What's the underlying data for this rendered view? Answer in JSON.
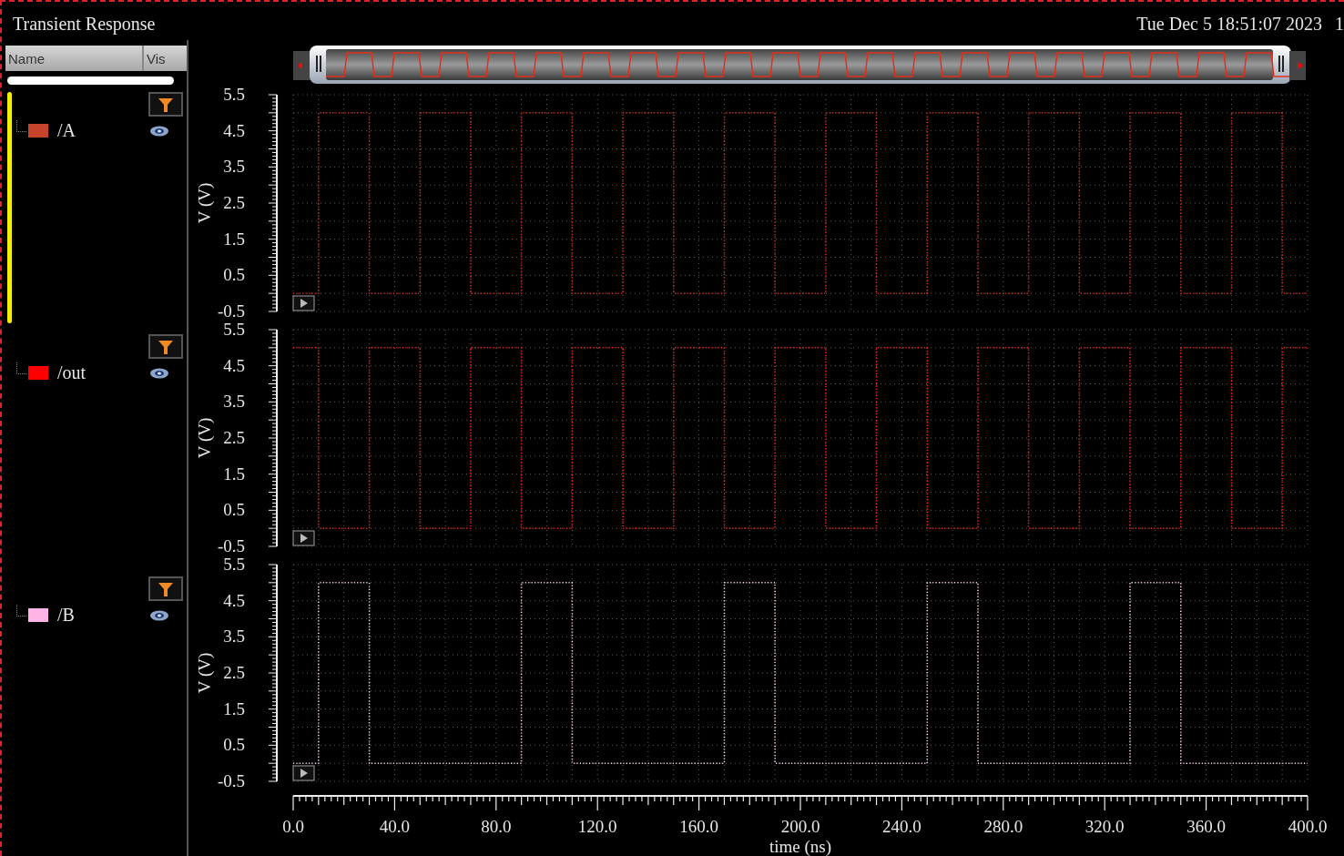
{
  "title": "Transient Response",
  "timestamp": "Tue Dec 5 18:51:07 2023",
  "cut_text": "1",
  "columns": [
    "Name",
    "Vis"
  ],
  "signals": [
    {
      "name": "/A",
      "color": "#c8432b",
      "selected": true,
      "chart_data": {
        "type": "line",
        "ylabel": "V (V)",
        "xlim": [
          0,
          400
        ],
        "ylim": [
          -0.5,
          5.5
        ],
        "yticks": [
          -0.5,
          0.5,
          1.5,
          2.5,
          3.5,
          4.5,
          5.5
        ],
        "x": [
          0,
          10,
          10,
          30,
          30,
          50,
          50,
          70,
          70,
          90,
          90,
          110,
          110,
          130,
          130,
          150,
          150,
          170,
          170,
          190,
          190,
          210,
          210,
          230,
          230,
          250,
          250,
          270,
          270,
          290,
          290,
          310,
          310,
          330,
          330,
          350,
          350,
          370,
          370,
          390,
          390,
          400
        ],
        "grid": true,
        "series": [
          {
            "line_style": "dotted",
            "color": "#d42a1e",
            "values": [
              0,
              0,
              5,
              5,
              0,
              0,
              5,
              5,
              0,
              0,
              5,
              5,
              0,
              0,
              5,
              5,
              0,
              0,
              5,
              5,
              0,
              0,
              5,
              5,
              0,
              0,
              5,
              5,
              0,
              0,
              5,
              5,
              0,
              0,
              5,
              5,
              0,
              0,
              5,
              5,
              0,
              0
            ]
          }
        ]
      }
    },
    {
      "name": "/out",
      "color": "#ff0000",
      "selected": false,
      "chart_data": {
        "type": "line",
        "ylabel": "V (V)",
        "xlim": [
          0,
          400
        ],
        "ylim": [
          -0.5,
          5.5
        ],
        "yticks": [
          -0.5,
          0.5,
          1.5,
          2.5,
          3.5,
          4.5,
          5.5
        ],
        "x": [
          0,
          10,
          10,
          30,
          30,
          50,
          50,
          70,
          70,
          90,
          90,
          110,
          110,
          130,
          130,
          150,
          150,
          170,
          170,
          190,
          190,
          210,
          210,
          230,
          230,
          250,
          250,
          270,
          270,
          290,
          290,
          310,
          310,
          330,
          330,
          350,
          350,
          370,
          370,
          390,
          390,
          400
        ],
        "grid": true,
        "series": [
          {
            "line_style": "dotted",
            "color": "#ff1a1a",
            "values": [
              5,
              5,
              0,
              0,
              5,
              5,
              0,
              0,
              5,
              5,
              0,
              0,
              5,
              5,
              0,
              0,
              5,
              5,
              0,
              0,
              5,
              5,
              0,
              0,
              5,
              5,
              0,
              0,
              5,
              5,
              0,
              0,
              5,
              5,
              0,
              0,
              5,
              5,
              0,
              0,
              5,
              5
            ]
          }
        ]
      }
    },
    {
      "name": "/B",
      "color": "#ffb3e6",
      "selected": false,
      "chart_data": {
        "type": "line",
        "xlabel": "time (ns)",
        "ylabel": "V (V)",
        "xlim": [
          0,
          400
        ],
        "ylim": [
          -0.5,
          5.5
        ],
        "yticks": [
          -0.5,
          0.5,
          1.5,
          2.5,
          3.5,
          4.5,
          5.5
        ],
        "xticks": [
          {
            "value": 0,
            "label": "0.0"
          },
          {
            "value": 40,
            "label": "40.0"
          },
          {
            "value": 80,
            "label": "80.0"
          },
          {
            "value": 120,
            "label": "120.0"
          },
          {
            "value": 160,
            "label": "160.0"
          },
          {
            "value": 200,
            "label": "200.0"
          },
          {
            "value": 240,
            "label": "240.0"
          },
          {
            "value": 280,
            "label": "280.0"
          },
          {
            "value": 320,
            "label": "320.0"
          },
          {
            "value": 360,
            "label": "360.0"
          },
          {
            "value": 400,
            "label": "400.0"
          }
        ],
        "x": [
          0,
          10,
          10,
          30,
          30,
          50,
          50,
          70,
          70,
          90,
          90,
          110,
          110,
          130,
          130,
          150,
          150,
          170,
          170,
          190,
          190,
          210,
          210,
          230,
          230,
          250,
          250,
          270,
          270,
          290,
          290,
          310,
          310,
          330,
          330,
          350,
          350,
          370,
          370,
          390,
          390,
          400
        ],
        "grid": true,
        "series": [
          {
            "line_style": "dotted",
            "color": "#ffd0f0",
            "values": [
              0,
              0,
              5,
              5,
              0,
              0,
              0,
              0,
              0,
              0,
              5,
              5,
              0,
              0,
              0,
              0,
              0,
              0,
              5,
              5,
              0,
              0,
              0,
              0,
              0,
              0,
              5,
              5,
              0,
              0,
              0,
              0,
              0,
              0,
              5,
              5,
              0,
              0,
              0,
              0,
              0,
              0
            ]
          }
        ]
      }
    }
  ]
}
